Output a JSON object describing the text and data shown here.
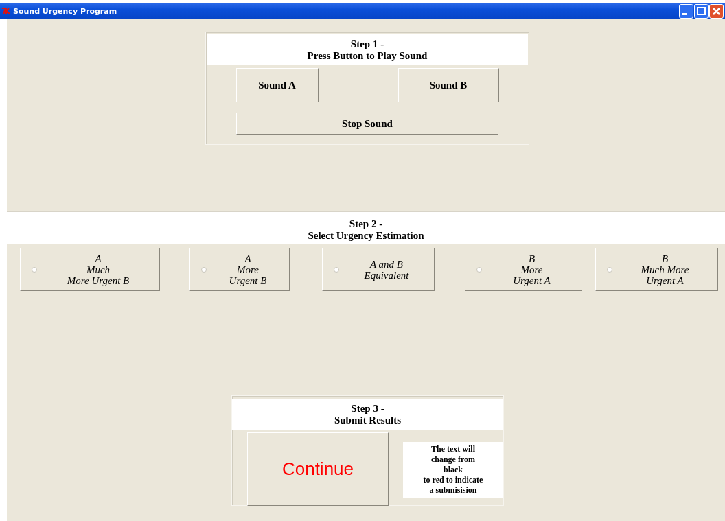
{
  "window": {
    "title": "Sound Urgency Program"
  },
  "step1": {
    "title": [
      "Step 1 -",
      "Press Button to Play Sound"
    ],
    "buttons": [
      "Sound A",
      "Sound B"
    ],
    "stop_button": "Stop Sound"
  },
  "step2": {
    "title": [
      "Step 2 -",
      "Select Urgency Estimation"
    ],
    "options": [
      {
        "lines": [
          "A",
          "Much",
          "More Urgent B"
        ],
        "selected": false
      },
      {
        "lines": [
          "A",
          "More",
          "Urgent B"
        ],
        "selected": false
      },
      {
        "lines": [
          "A and B",
          "Equivalent"
        ],
        "selected": false
      },
      {
        "lines": [
          "B",
          "More",
          "Urgent A"
        ],
        "selected": false
      },
      {
        "lines": [
          "B",
          "Much More",
          "Urgent A"
        ],
        "selected": false
      }
    ]
  },
  "step3": {
    "title": [
      "Step 3 -",
      "Submit Results"
    ],
    "continue_button": {
      "label": "Continue",
      "submitted": true
    },
    "note": [
      "The text will",
      "change from",
      "black",
      "to red to indicate",
      "a submisision"
    ]
  }
}
